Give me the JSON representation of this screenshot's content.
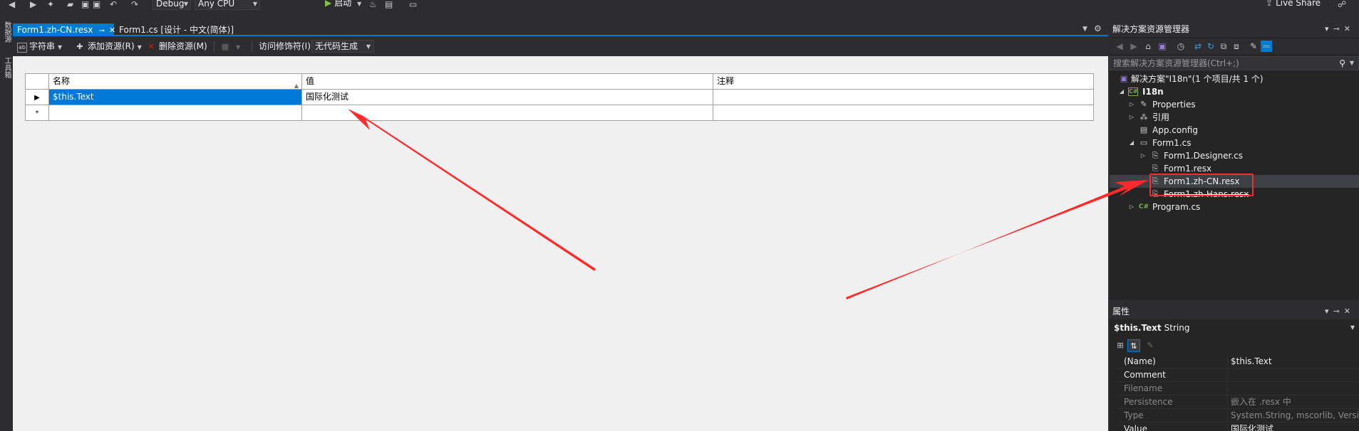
{
  "toolbar": {
    "config": "Debug",
    "platform": "Any CPU",
    "start_label": "启动",
    "live_share": "Live Share"
  },
  "left_strip": {
    "tab1": "数据源",
    "tab2": "工具箱"
  },
  "doc_tabs": [
    {
      "label": "Form1.zh-CN.resx",
      "active": true
    },
    {
      "label": "Form1.cs [设计 - 中文(简体)]",
      "active": false
    }
  ],
  "resource_toolbar": {
    "strings_label": "字符串",
    "add_resource_label": "添加资源(R)",
    "remove_resource_label": "删除资源(M)",
    "access_modifier_label": "访问修饰符(I):",
    "access_modifier_value": "无代码生成"
  },
  "grid": {
    "headers": [
      "名称",
      "值",
      "注释"
    ],
    "rows": [
      {
        "name": "$this.Text",
        "value": "国际化测试",
        "comment": ""
      }
    ],
    "new_row_marker": "*"
  },
  "solution_explorer": {
    "title": "解决方案资源管理器",
    "search_placeholder": "搜索解决方案资源管理器(Ctrl+;)",
    "solution_label": "解决方案\"I18n\"(1 个项目/共 1 个)",
    "project_label": "I18n",
    "nodes": {
      "properties": "Properties",
      "references": "引用",
      "app_config": "App.config",
      "form1": "Form1.cs",
      "form1_designer": "Form1.Designer.cs",
      "form1_resx": "Form1.resx",
      "form1_zhcn": "Form1.zh-CN.resx",
      "form1_zhhans": "Form1.zh-Hans.resx",
      "program": "Program.cs"
    }
  },
  "properties": {
    "title": "属性",
    "object_name": "$this.Text",
    "object_type": "String",
    "rows": [
      {
        "name": "(Name)",
        "value": "$this.Text",
        "dim": false
      },
      {
        "name": "Comment",
        "value": "",
        "dim": false
      },
      {
        "name": "Filename",
        "value": "",
        "dim": true
      },
      {
        "name": "Persistence",
        "value": "嵌入在 .resx 中",
        "dim": true
      },
      {
        "name": "Type",
        "value": "System.String, mscorlib, Version=",
        "dim": true
      },
      {
        "name": "Value",
        "value": "国际化测试",
        "dim": false
      }
    ]
  },
  "colors": {
    "accent": "#007acc",
    "selection": "#0078d7",
    "annotation": "#ff2a2a"
  }
}
